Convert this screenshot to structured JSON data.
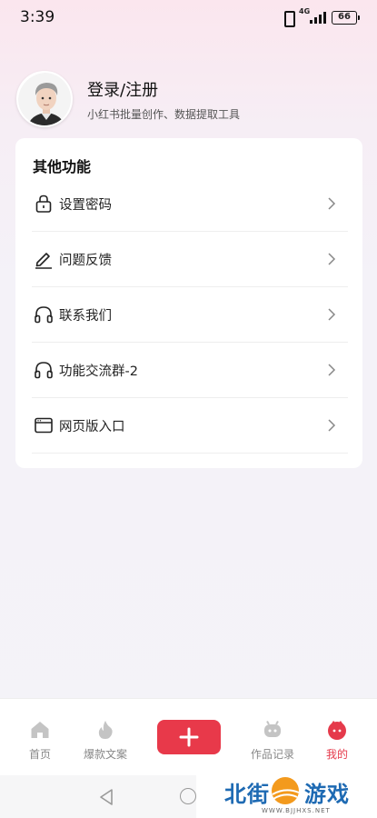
{
  "status_bar": {
    "time": "3:39",
    "network": "4G",
    "battery": "66"
  },
  "profile": {
    "title": "登录/注册",
    "subtitle": "小红书批量创作、数据提取工具"
  },
  "card": {
    "title": "其他功能",
    "items": [
      {
        "label": "设置密码",
        "icon": "lock-icon"
      },
      {
        "label": "问题反馈",
        "icon": "pen-icon"
      },
      {
        "label": "联系我们",
        "icon": "headphones-icon"
      },
      {
        "label": "功能交流群-2",
        "icon": "headphones-icon"
      },
      {
        "label": "网页版入口",
        "icon": "browser-window-icon"
      }
    ]
  },
  "bottom_nav": {
    "home": "首页",
    "hot": "爆款文案",
    "works": "作品记录",
    "mine": "我的",
    "add_icon": "plus-icon"
  },
  "watermark": {
    "left": "北街",
    "right": "游戏",
    "url": "WWW.BJJHXS.NET"
  },
  "colors": {
    "accent": "#e8394a",
    "active_tab": "#e53a4b"
  }
}
